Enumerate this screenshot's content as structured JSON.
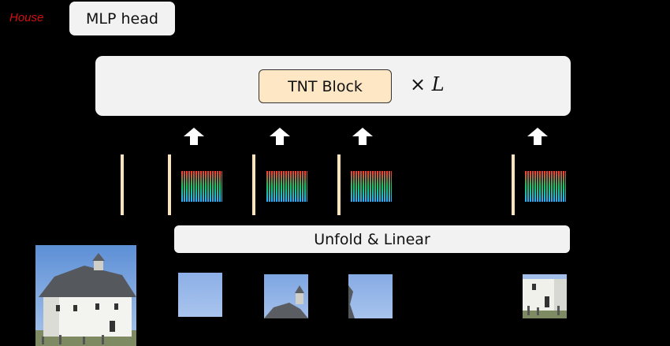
{
  "prediction_label": "House",
  "mlp_head_label": "MLP head",
  "tnt_block_label": "TNT Block",
  "repeat_symbol": "×",
  "repeat_variable": "L",
  "unfold_label": "Unfold & Linear",
  "colors": {
    "background": "#000000",
    "box_fill": "#f2f2f2",
    "tnt_block_fill": "#fde7c4",
    "token_bar": "#fbe3be",
    "prediction_text": "#d01010",
    "arrow": "#ffffff",
    "pixel_embedding_gradient": [
      "#ff3a2e",
      "#19c46a",
      "#28b0ff"
    ]
  },
  "pixel_embeddings_count": 4,
  "image_patches_count": 4
}
